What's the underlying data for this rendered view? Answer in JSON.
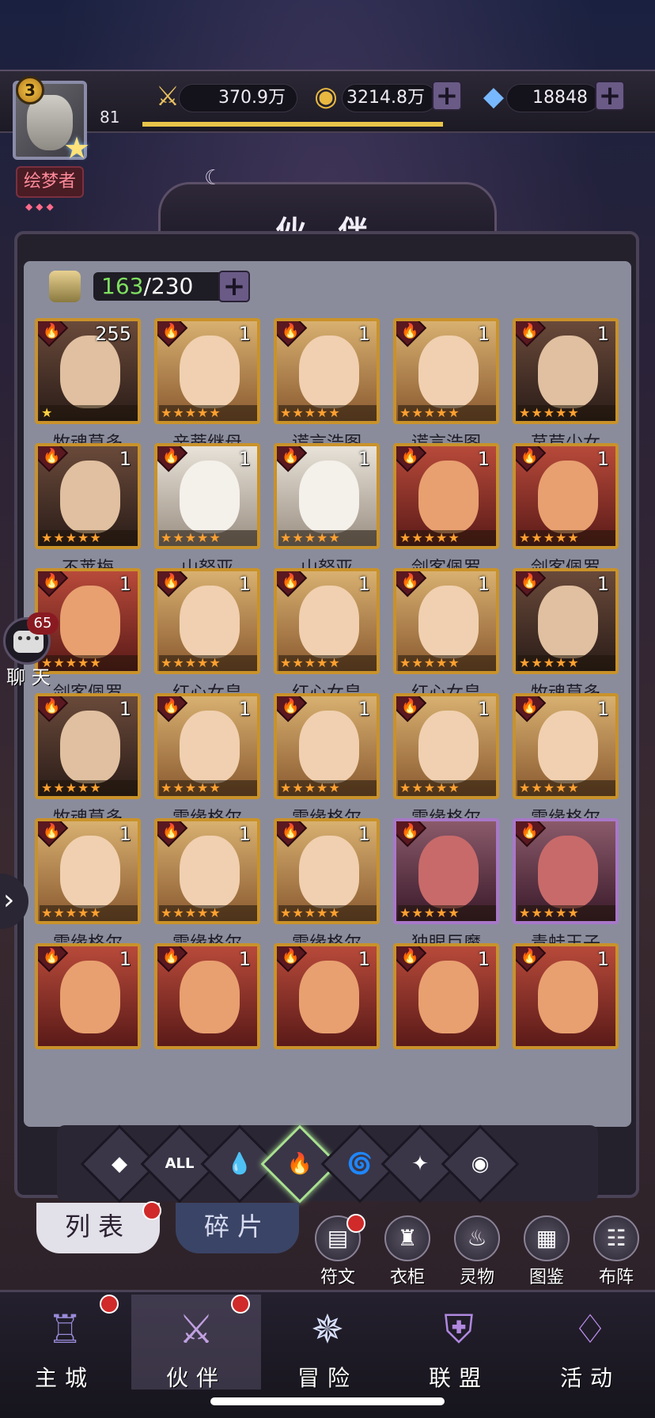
{
  "player": {
    "vip": "3",
    "level": "81",
    "title": "绘梦者"
  },
  "resources": {
    "power": "370.9万",
    "gold": "3214.8万",
    "diamonds": "18848"
  },
  "header": {
    "title": "伙 伴"
  },
  "roster": {
    "current": "163",
    "max": "/230"
  },
  "partners": [
    {
      "name": "牧魂莫多",
      "count": "255",
      "stars": "★",
      "tone": "dark"
    },
    {
      "name": "辛蒂继母",
      "count": "1",
      "stars": "★★★★★",
      "tone": "gold"
    },
    {
      "name": "谎言浩图",
      "count": "1",
      "stars": "★★★★★",
      "tone": "gold"
    },
    {
      "name": "谎言浩图",
      "count": "1",
      "stars": "★★★★★",
      "tone": "gold"
    },
    {
      "name": "莴苣少女",
      "count": "1",
      "stars": "★★★★★",
      "tone": "dark"
    },
    {
      "name": "不莱梅",
      "count": "1",
      "stars": "★★★★★",
      "tone": "dark"
    },
    {
      "name": "山努亚",
      "count": "1",
      "stars": "★★★★★",
      "tone": "light"
    },
    {
      "name": "山努亚",
      "count": "1",
      "stars": "★★★★★",
      "tone": "light"
    },
    {
      "name": "剑客佩罗",
      "count": "1",
      "stars": "★★★★★",
      "tone": "red"
    },
    {
      "name": "剑客佩罗",
      "count": "1",
      "stars": "★★★★★",
      "tone": "red"
    },
    {
      "name": "剑客佩罗",
      "count": "1",
      "stars": "★★★★★",
      "tone": "red"
    },
    {
      "name": "红心女皇",
      "count": "1",
      "stars": "★★★★★",
      "tone": "gold"
    },
    {
      "name": "红心女皇",
      "count": "1",
      "stars": "★★★★★",
      "tone": "gold"
    },
    {
      "name": "红心女皇",
      "count": "1",
      "stars": "★★★★★",
      "tone": "gold"
    },
    {
      "name": "牧魂莫多",
      "count": "1",
      "stars": "★★★★★",
      "tone": "dark"
    },
    {
      "name": "牧魂莫多",
      "count": "1",
      "stars": "★★★★★",
      "tone": "dark"
    },
    {
      "name": "雪缘格尔",
      "count": "1",
      "stars": "★★★★★",
      "tone": "gold"
    },
    {
      "name": "雪缘格尔",
      "count": "1",
      "stars": "★★★★★",
      "tone": "gold"
    },
    {
      "name": "雪缘格尔",
      "count": "1",
      "stars": "★★★★★",
      "tone": "gold"
    },
    {
      "name": "雪缘格尔",
      "count": "1",
      "stars": "★★★★★",
      "tone": "gold"
    },
    {
      "name": "雪缘格尔",
      "count": "1",
      "stars": "★★★★★",
      "tone": "gold"
    },
    {
      "name": "雪缘格尔",
      "count": "1",
      "stars": "★★★★★",
      "tone": "gold"
    },
    {
      "name": "雪缘格尔",
      "count": "1",
      "stars": "★★★★★",
      "tone": "gold"
    },
    {
      "name": "独眼巨魔",
      "count": "",
      "stars": "★★★★★",
      "tone": "purple"
    },
    {
      "name": "青蛙王子",
      "count": "",
      "stars": "★★★★★",
      "tone": "purple"
    },
    {
      "name": "",
      "count": "1",
      "stars": "",
      "tone": "red"
    },
    {
      "name": "",
      "count": "1",
      "stars": "",
      "tone": "red"
    },
    {
      "name": "",
      "count": "1",
      "stars": "",
      "tone": "red"
    },
    {
      "name": "",
      "count": "1",
      "stars": "",
      "tone": "red"
    },
    {
      "name": "",
      "count": "1",
      "stars": "",
      "tone": "red"
    }
  ],
  "filters": [
    {
      "icon": "◆",
      "active": false
    },
    {
      "icon": "ALL",
      "active": false
    },
    {
      "icon": "💧",
      "active": false
    },
    {
      "icon": "🔥",
      "active": true
    },
    {
      "icon": "🌀",
      "active": false
    },
    {
      "icon": "✦",
      "active": false
    },
    {
      "icon": "◉",
      "active": false
    }
  ],
  "tabs": {
    "list": "列表",
    "fragments": "碎片"
  },
  "side_actions": [
    {
      "label": "符文",
      "icon": "▤"
    },
    {
      "label": "衣柜",
      "icon": "♜"
    },
    {
      "label": "灵物",
      "icon": "♨"
    },
    {
      "label": "图鉴",
      "icon": "▦"
    },
    {
      "label": "布阵",
      "icon": "☷"
    }
  ],
  "chat": {
    "badge": "65",
    "label": "聊 天"
  },
  "nav": [
    {
      "label": "主城",
      "icon": "♖"
    },
    {
      "label": "伙伴",
      "icon": "⚔"
    },
    {
      "label": "冒险",
      "icon": "✵"
    },
    {
      "label": "联盟",
      "icon": "⛨"
    },
    {
      "label": "活动",
      "icon": "♢"
    }
  ],
  "colors": {
    "gold_frame": "#c9922a",
    "purple_frame": "#a878c8",
    "fire": "#ff6a5a",
    "count_green": "#7ee060"
  }
}
